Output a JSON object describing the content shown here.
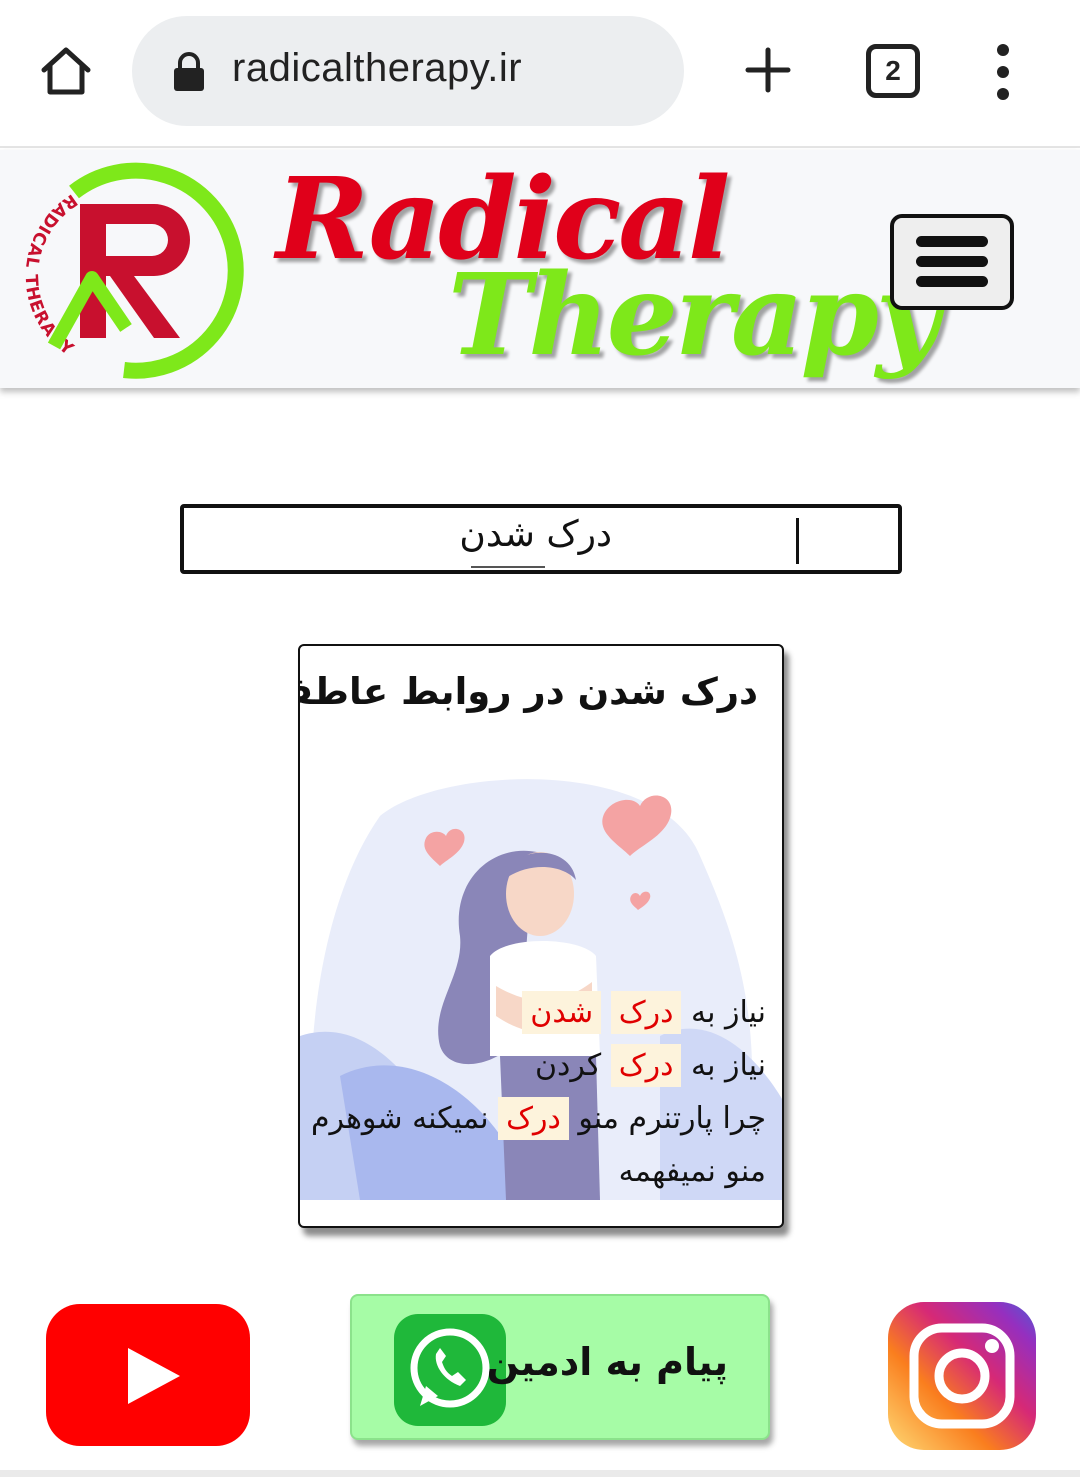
{
  "browser": {
    "url": "radicaltherapy.ir",
    "tab_count": "2",
    "icons": [
      "home-icon",
      "lock-icon",
      "plus-icon",
      "tabs-icon",
      "more-vert-icon"
    ]
  },
  "header": {
    "brand_line1": "Radical",
    "brand_line2": "Therapy",
    "logo_ring_text": "RADICAL THERAPY",
    "logo_letter": "R",
    "colors": {
      "red": "#e0001a",
      "green": "#7ee81a",
      "header_bg": "#f7f8fa"
    }
  },
  "search": {
    "value": "درک شدن"
  },
  "result_card": {
    "title": "درک شدن در روابط عاطفی",
    "lines": [
      [
        {
          "t": "نیاز به",
          "hl": false
        },
        {
          "t": "درک",
          "hl": true
        },
        {
          "t": "شدن",
          "hl": true
        }
      ],
      [
        {
          "t": "نیاز به",
          "hl": false
        },
        {
          "t": "درک",
          "hl": true
        },
        {
          "t": "کردن",
          "hl": false
        }
      ],
      [
        {
          "t": "چرا پارتنرم منو",
          "hl": false
        },
        {
          "t": "درک",
          "hl": true
        },
        {
          "t": "نمیکنه شوهرم",
          "hl": false
        }
      ],
      [
        {
          "t": "منو نمیفهمه",
          "hl": false
        }
      ]
    ],
    "highlight_color": "#e00000",
    "highlight_bg": "#fdf3dc"
  },
  "footer": {
    "whatsapp_label": "پیام به ادمین",
    "whatsapp_bg": "#a6fca6",
    "icons": [
      "youtube-icon",
      "whatsapp-icon",
      "instagram-icon"
    ]
  }
}
